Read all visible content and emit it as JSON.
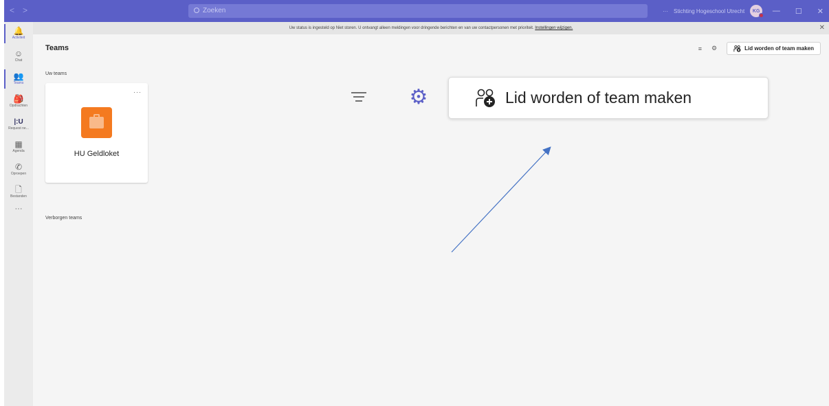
{
  "titlebar": {
    "back": "<",
    "forward": ">",
    "search_placeholder": "Zoeken",
    "more": "···",
    "org_name": "Stichting Hogeschool Utrecht",
    "avatar_initials": "KG",
    "minimize": "—",
    "maximize": "☐",
    "close": "✕"
  },
  "rail": {
    "items": [
      {
        "label": "Activiteit",
        "icon": "bell-icon",
        "glyph": "🔔"
      },
      {
        "label": "Chat",
        "icon": "chat-icon",
        "glyph": "☺"
      },
      {
        "label": "Teams",
        "icon": "teams-icon",
        "glyph": "👥"
      },
      {
        "label": "Opdrachten",
        "icon": "assignments-icon",
        "glyph": "🎒"
      },
      {
        "label": "Request ne...",
        "icon": "hu-icon",
        "glyph": "|:U"
      },
      {
        "label": "Agenda",
        "icon": "calendar-icon",
        "glyph": "▦"
      },
      {
        "label": "Oproepen",
        "icon": "phone-icon",
        "glyph": "✆"
      },
      {
        "label": "Bestanden",
        "icon": "file-icon",
        "glyph": "🗋"
      }
    ],
    "more": "···"
  },
  "banner": {
    "text": "Uw status is ingesteld op Niet storen. U ontvangt alleen meldingen voor dringende berichten en van uw contactpersonen met prioriteit.",
    "link": "Instellingen wijzigen.",
    "close": "✕"
  },
  "page": {
    "title": "Teams",
    "your_teams_label": "Uw teams",
    "hidden_teams_label": "Verborgen teams",
    "join_button": "Lid worden of team maken",
    "filter_glyph": "≡",
    "settings_glyph": "⚙"
  },
  "teams": [
    {
      "name": "HU Geldloket",
      "more": "···",
      "logo_color": "#f47a20"
    }
  ],
  "callout": {
    "join_button": "Lid worden of team maken",
    "gear_glyph": "⚙",
    "accent": "#5b5fc7",
    "arrow_color": "#4472c4"
  }
}
